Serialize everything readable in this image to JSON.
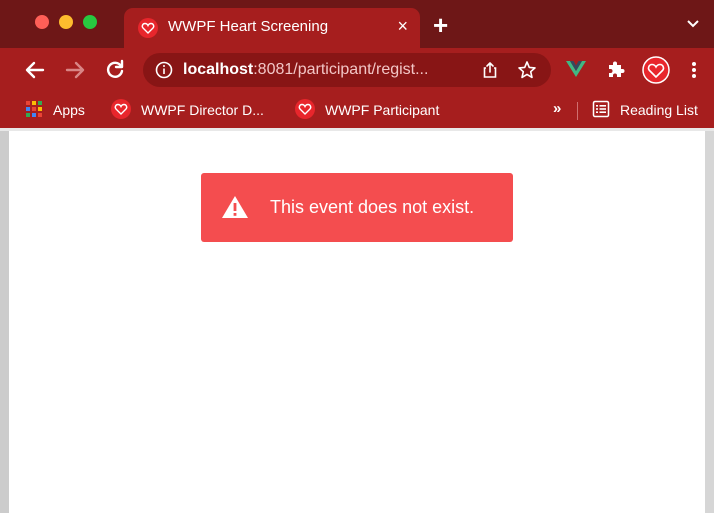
{
  "browser": {
    "tab": {
      "title": "WWPF Heart Screening",
      "close_glyph": "×",
      "favicon": "heart-logo-icon"
    },
    "new_tab_glyph": "+",
    "address": {
      "host": "localhost",
      "rest": ":8081/participant/regist..."
    },
    "bookmarks": {
      "apps_label": "Apps",
      "items": [
        {
          "label": "WWPF Director D..."
        },
        {
          "label": "WWPF Participant"
        }
      ],
      "more_glyph": "»",
      "reading_list_label": "Reading List"
    },
    "colors": {
      "tabstrip": "#6e1717",
      "toolbar": "#a61e1e",
      "omnibox": "#881515",
      "alert": "#f44d4f",
      "brand_red": "#e8262c"
    }
  },
  "page": {
    "alert": {
      "icon": "warning-icon",
      "message": "This event does not exist."
    }
  }
}
